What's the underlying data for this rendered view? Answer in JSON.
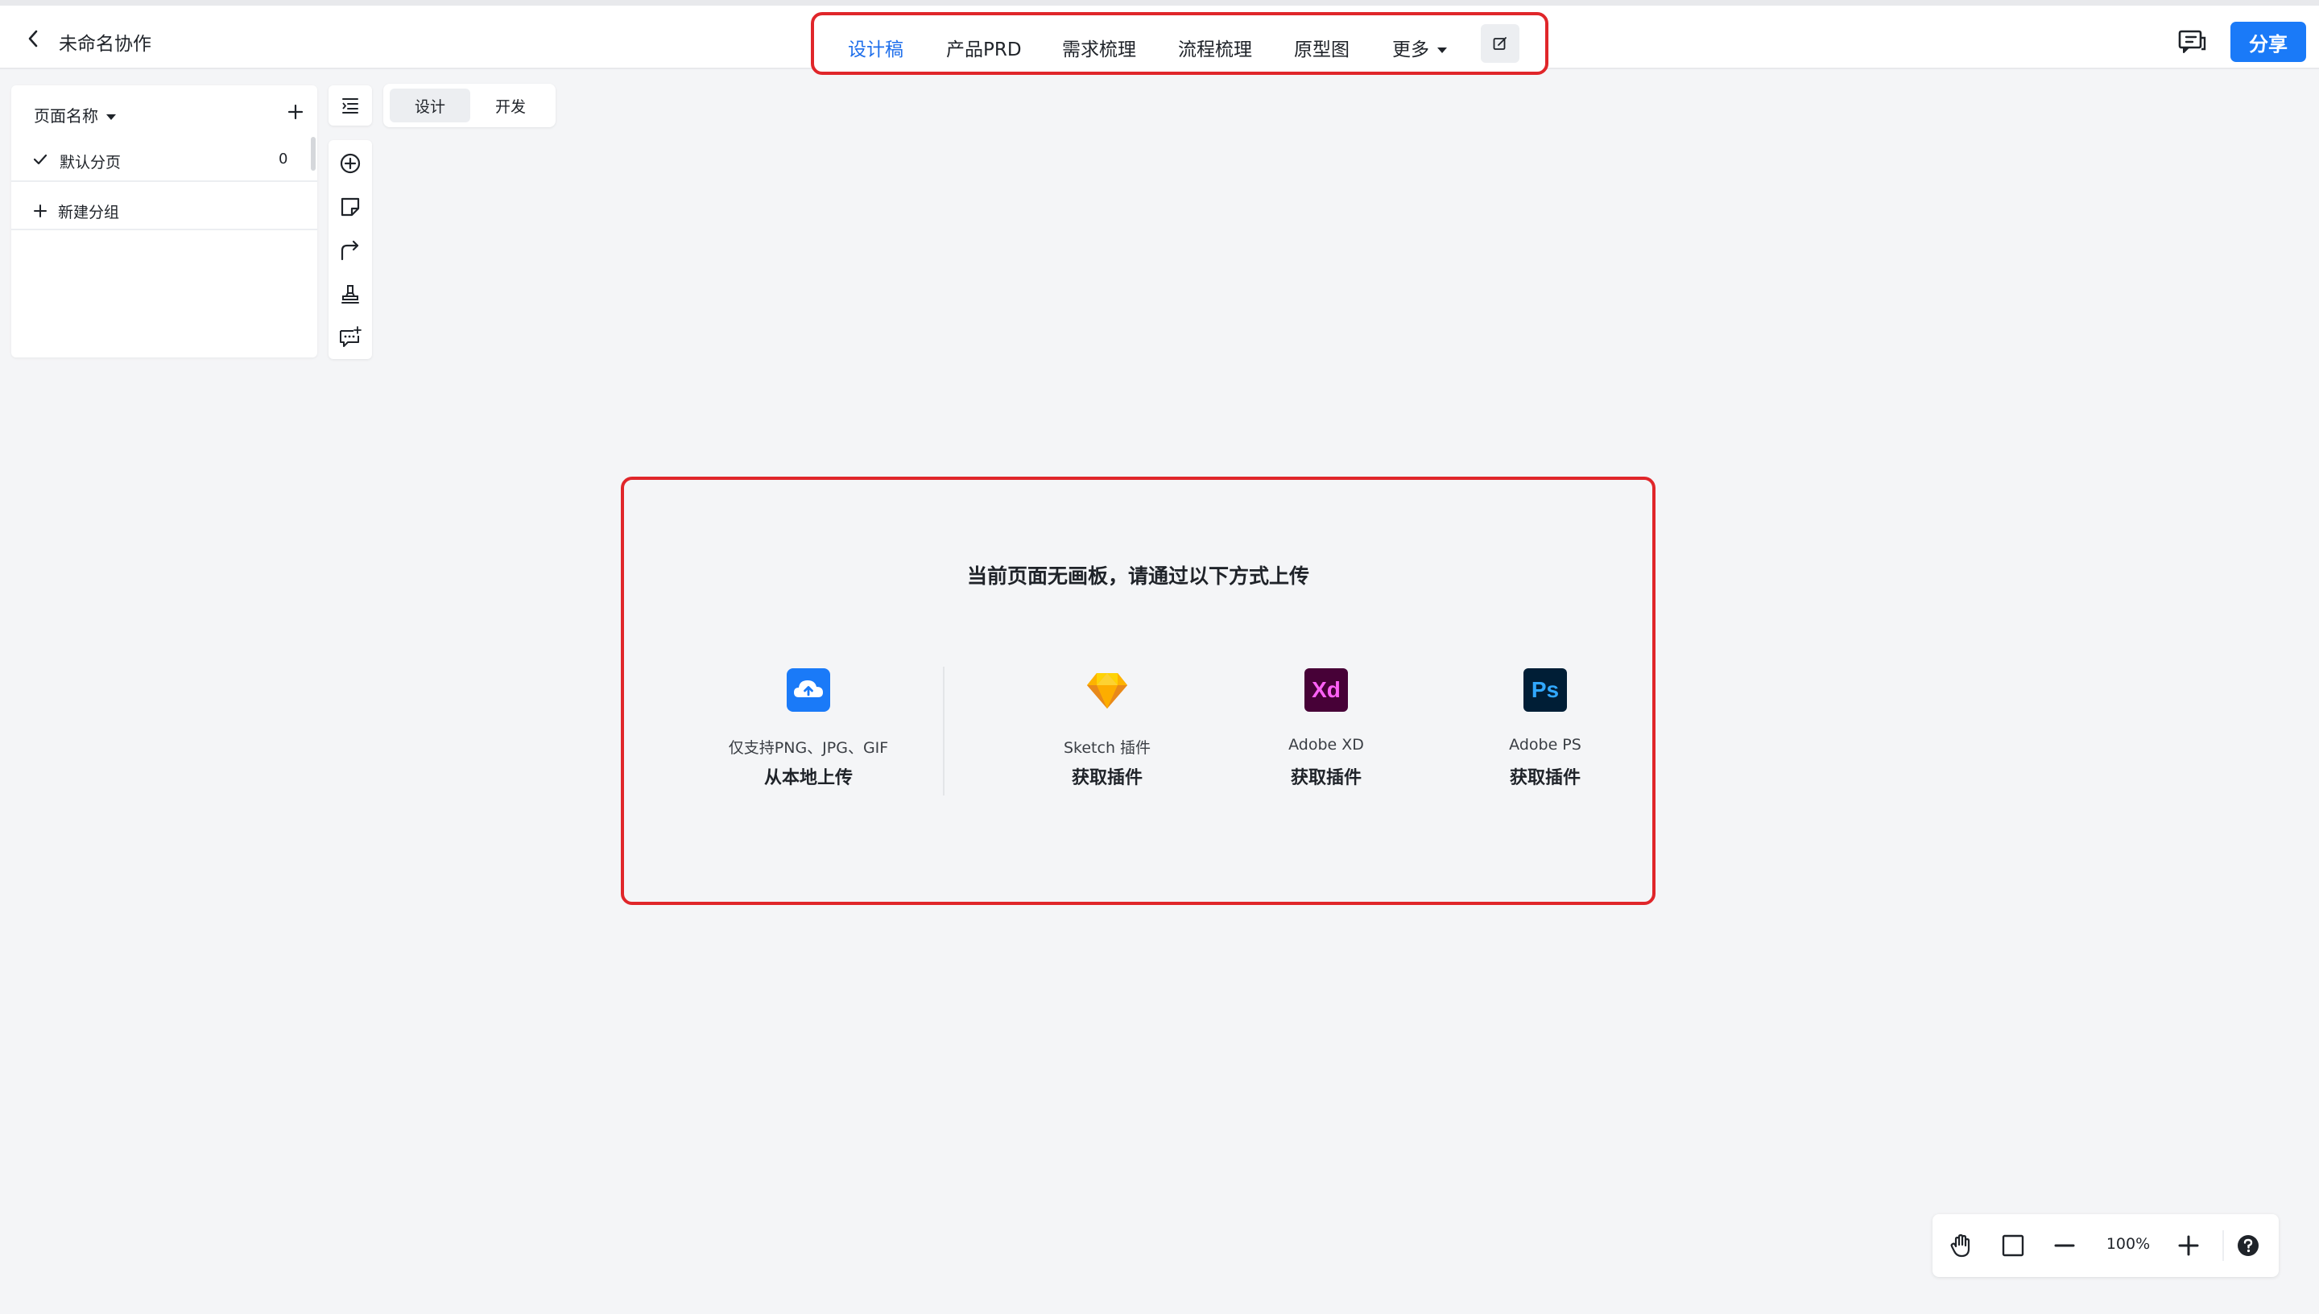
{
  "header": {
    "title": "未命名协作",
    "tabs": [
      {
        "label": "设计稿",
        "active": true
      },
      {
        "label": "产品PRD",
        "active": false
      },
      {
        "label": "需求梳理",
        "active": false
      },
      {
        "label": "流程梳理",
        "active": false
      },
      {
        "label": "原型图",
        "active": false
      },
      {
        "label": "更多",
        "active": false
      }
    ],
    "share_label": "分享",
    "accent_color": "#1a7af8",
    "highlight_color": "#e0262a"
  },
  "pages_panel": {
    "header_label": "页面名称",
    "pages": [
      {
        "name": "默认分页",
        "count": "0",
        "selected": true
      }
    ],
    "new_group_label": "新建分组"
  },
  "toolbar": {
    "icons": [
      "outline-list-icon",
      "add-circle-icon",
      "sticky-note-icon",
      "connector-arrow-icon",
      "stamp-icon",
      "ai-comment-icon"
    ]
  },
  "mode_toggle": {
    "options": [
      {
        "label": "设计",
        "active": true
      },
      {
        "label": "开发",
        "active": false
      }
    ]
  },
  "upload": {
    "title": "当前页面无画板，请通过以下方式上传",
    "options": [
      {
        "sub": "仅支持PNG、JPG、GIF",
        "main": "从本地上传",
        "icon": "cloud-upload-icon"
      },
      {
        "sub": "Sketch 插件",
        "main": "获取插件",
        "icon": "sketch-icon"
      },
      {
        "sub": "Adobe XD",
        "main": "获取插件",
        "icon": "adobe-xd-icon",
        "icon_text": "Xd"
      },
      {
        "sub": "Adobe PS",
        "main": "获取插件",
        "icon": "adobe-ps-icon",
        "icon_text": "Ps"
      }
    ]
  },
  "zoom": {
    "level": "100%"
  }
}
